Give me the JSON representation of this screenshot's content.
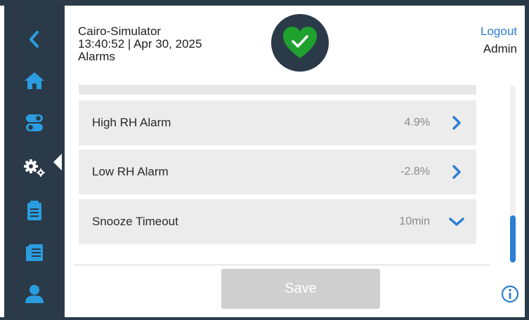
{
  "header": {
    "device_name": "Cairo-Simulator",
    "datetime": "13:40:52 | Apr 30, 2025",
    "page_title": "Alarms",
    "status_icon": "heart-check-icon",
    "logout_label": "Logout",
    "user": "Admin"
  },
  "sidebar": {
    "items": [
      {
        "name": "back",
        "icon": "chevron-left-icon"
      },
      {
        "name": "home",
        "icon": "home-icon"
      },
      {
        "name": "toggles",
        "icon": "toggle-switches-icon"
      },
      {
        "name": "settings",
        "icon": "gears-icon",
        "active": true
      },
      {
        "name": "log",
        "icon": "clipboard-icon"
      },
      {
        "name": "reports",
        "icon": "document-list-icon"
      },
      {
        "name": "users",
        "icon": "user-icon"
      }
    ]
  },
  "alarms": {
    "rows": [
      {
        "label": "High RH Alarm",
        "value": "4.9%",
        "chevron": "chevron-right-icon"
      },
      {
        "label": "Low RH Alarm",
        "value": "-2.8%",
        "chevron": "chevron-right-icon"
      },
      {
        "label": "Snooze Timeout",
        "value": "10min",
        "chevron": "chevron-down-icon"
      }
    ]
  },
  "actions": {
    "save_label": "Save"
  },
  "scroll": {
    "position_fraction": 0.74
  },
  "colors": {
    "sidebar": "#2b3a48",
    "accent": "#2a7fd4",
    "status_ok": "#1fa12f",
    "row_bg": "#ececec",
    "save_disabled": "#cfcfcf"
  }
}
